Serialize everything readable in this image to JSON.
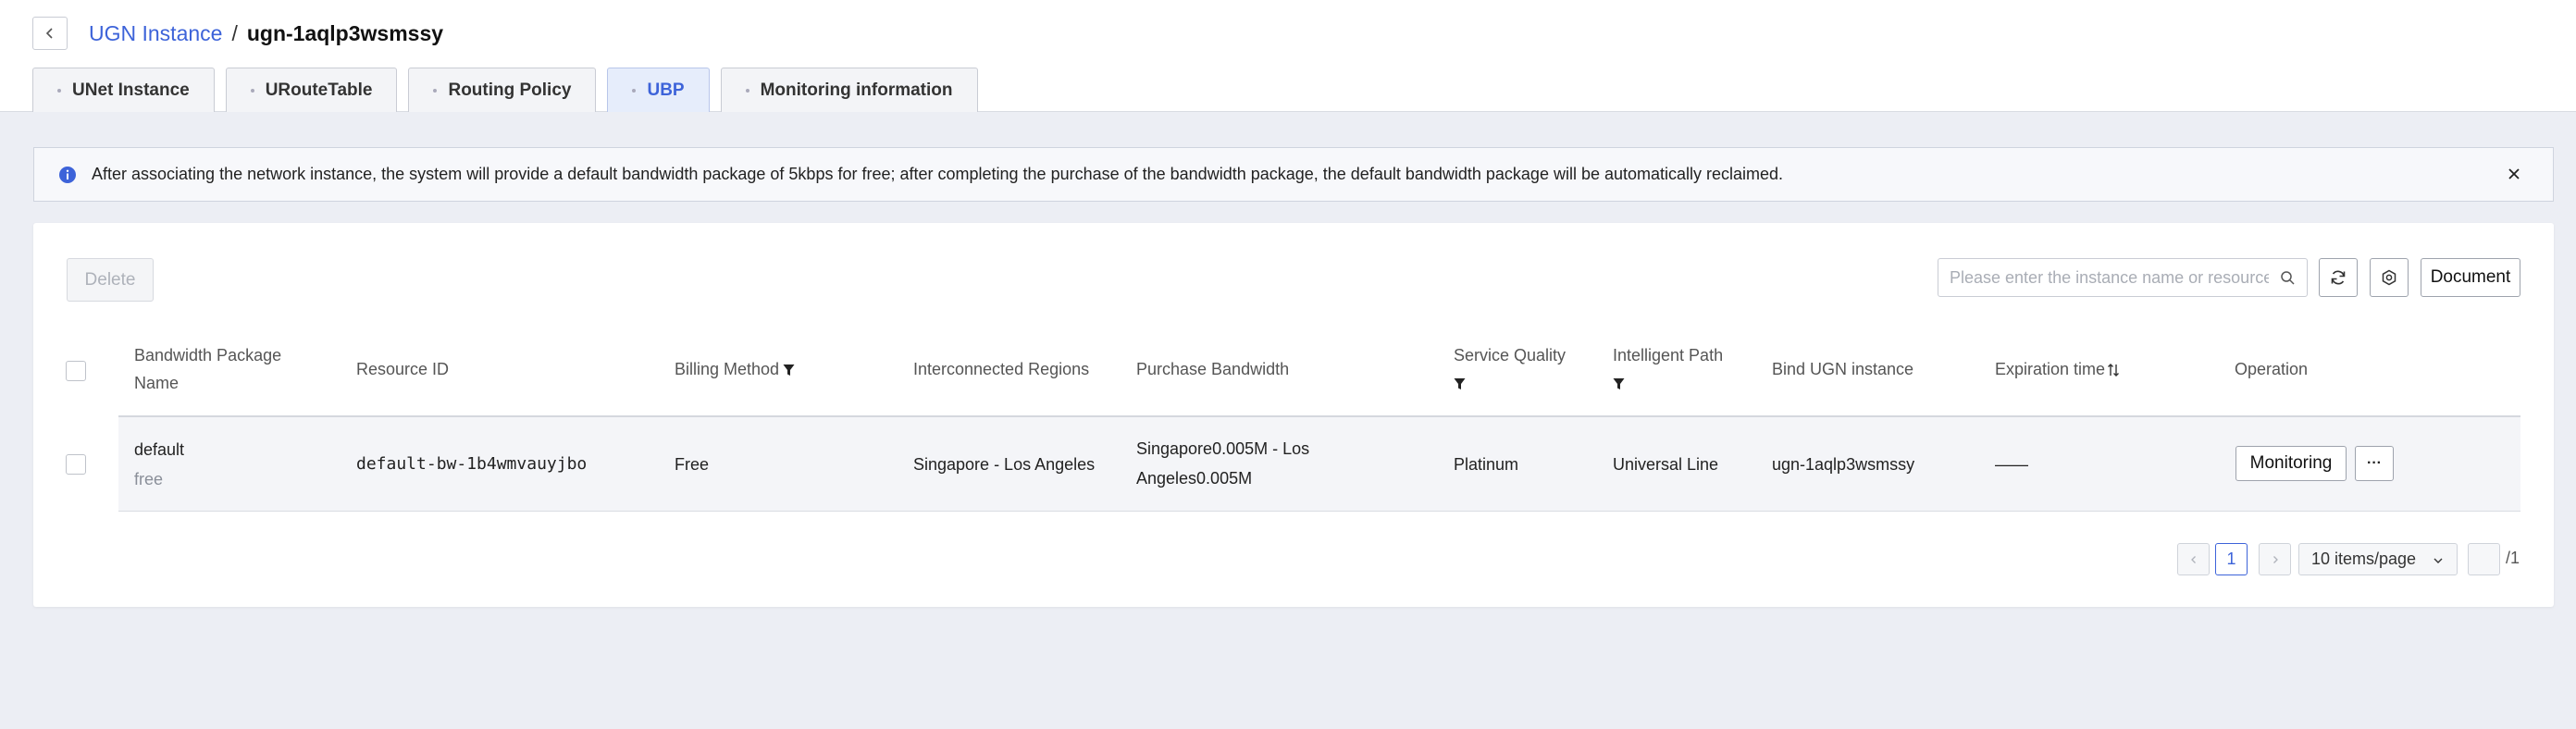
{
  "breadcrumb": {
    "parent": "UGN Instance",
    "separator": "/",
    "current": "ugn-1aqlp3wsmssy"
  },
  "tabs": [
    {
      "label": "UNet Instance",
      "active": false
    },
    {
      "label": "URouteTable",
      "active": false
    },
    {
      "label": "Routing Policy",
      "active": false
    },
    {
      "label": "UBP",
      "active": true
    },
    {
      "label": "Monitoring information",
      "active": false
    }
  ],
  "notice": {
    "text": "After associating the network instance, the system will provide a default bandwidth package of 5kbps for free; after completing the purchase of the bandwidth package, the default bandwidth package will be automatically reclaimed."
  },
  "toolbar": {
    "delete_label": "Delete",
    "search_placeholder": "Please enter the instance name or resource ID",
    "search_value": "",
    "document_label": "Document"
  },
  "table": {
    "headers": {
      "name_line1": "Bandwidth Package",
      "name_line2": "Name",
      "resource_id": "Resource ID",
      "billing": "Billing Method",
      "regions": "Interconnected Regions",
      "bandwidth": "Purchase Bandwidth",
      "quality": "Service Quality",
      "path": "Intelligent Path",
      "bind": "Bind UGN instance",
      "expiration": "Expiration time",
      "operation": "Operation"
    },
    "rows": [
      {
        "name": "default",
        "name_sub": "free",
        "resource_id": "default-bw-1b4wmvauyjbo",
        "billing": "Free",
        "regions": "Singapore - Los Angeles",
        "bandwidth_line1": "Singapore0.005M - Los",
        "bandwidth_line2": "Angeles0.005M",
        "quality": "Platinum",
        "path": "Universal Line",
        "bind": "ugn-1aqlp3wsmssy",
        "expiration": "——",
        "monitoring_label": "Monitoring",
        "more_label": "···"
      }
    ]
  },
  "pagination": {
    "current_page": "1",
    "page_size": "10 items/page",
    "total_pages": "/1"
  },
  "colors": {
    "accent": "#3d63d9",
    "page_bg": "#eceef4"
  },
  "icons": [
    "chevron-left-icon",
    "info-icon",
    "close-icon",
    "search-icon",
    "refresh-icon",
    "gear-icon",
    "filter-icon",
    "sort-icon",
    "chevron-right-icon",
    "chevron-down-icon"
  ]
}
